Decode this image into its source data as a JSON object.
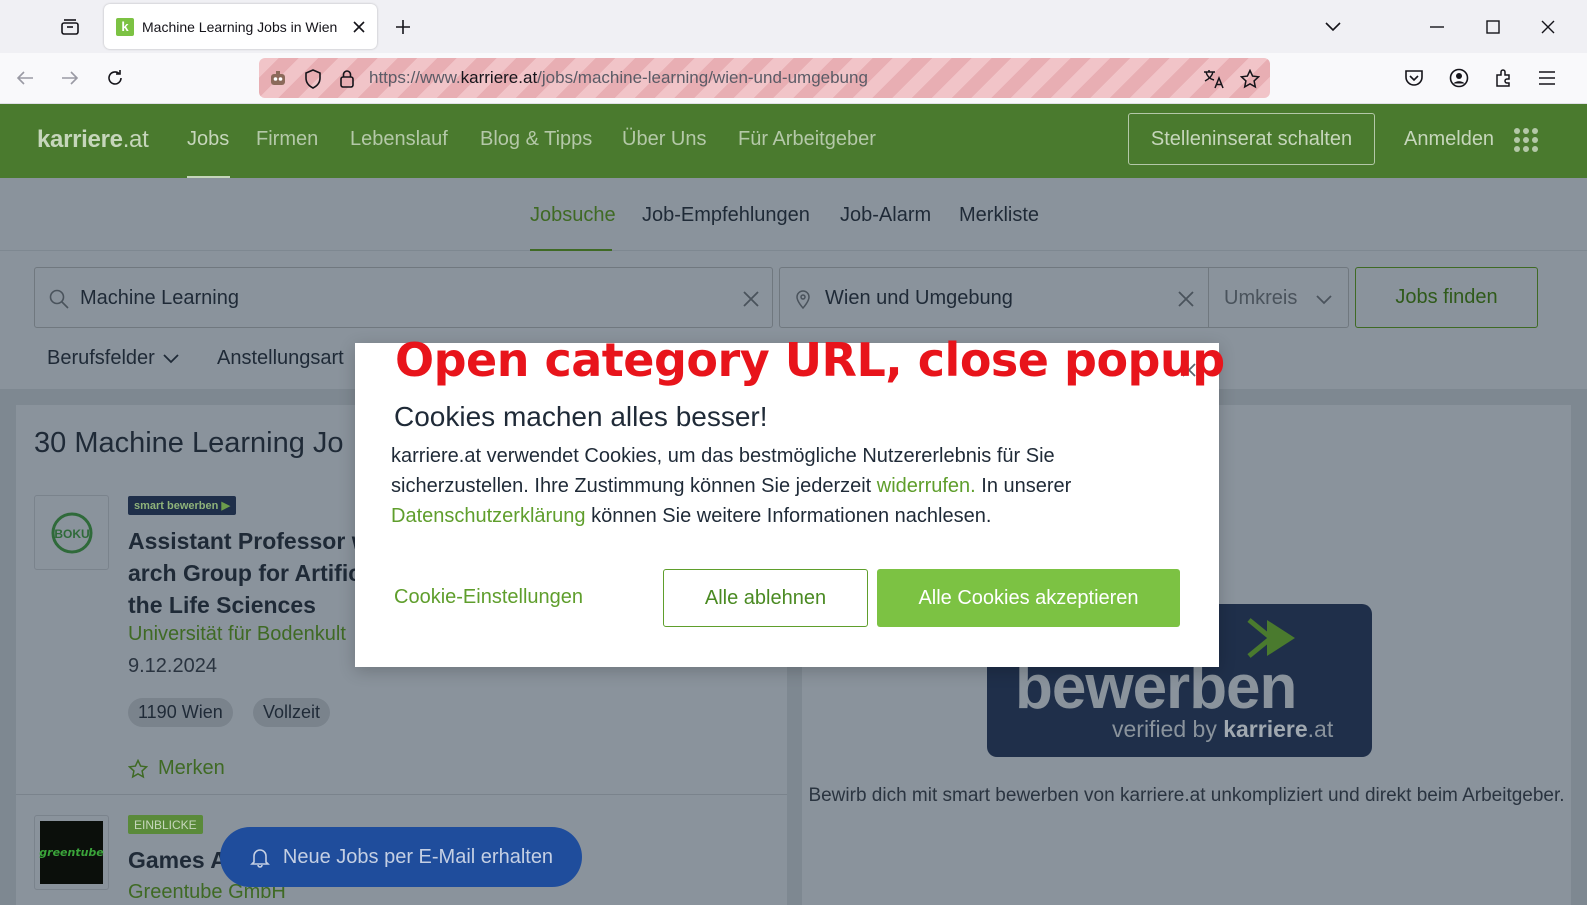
{
  "browser": {
    "tab_title": "Machine Learning Jobs in Wien",
    "url_prefix": "https://www.",
    "url_domain": "karriere.at",
    "url_path": "/jobs/machine-learning/wien-und-umgebung"
  },
  "header": {
    "logo_bold": "karriere",
    "logo_suffix": ".at",
    "nav": [
      "Jobs",
      "Firmen",
      "Lebenslauf",
      "Blog & Tipps",
      "Über Uns",
      "Für Arbeitgeber"
    ],
    "post_job": "Stelleninserat schalten",
    "login": "Anmelden"
  },
  "subnav": [
    "Jobsuche",
    "Job-Empfehlungen",
    "Job-Alarm",
    "Merkliste"
  ],
  "search": {
    "keyword": "Machine Learning",
    "location": "Wien und Umgebung",
    "radius": "Umkreis",
    "submit": "Jobs finden",
    "filters": [
      "Berufsfelder",
      "Anstellungsart"
    ]
  },
  "results": {
    "title": "30 Machine Learning Jo",
    "job1": {
      "badge": "smart bewerben",
      "logo_text": "BOKU",
      "title_lines": [
        "Assistant Professor w",
        "arch Group for Artific",
        "the Life Sciences"
      ],
      "company": "Universität für Bodenkult",
      "date": "9.12.2024",
      "tags": [
        "1190 Wien",
        "Vollzeit"
      ],
      "bookmark": "Merken"
    },
    "job2": {
      "badge": "EINBLICKE",
      "logo_text": "greentube",
      "title": "Games A",
      "company": "Greentube GmbH"
    }
  },
  "promo": {
    "word": "bewerben",
    "verified_prefix": "verified by ",
    "verified_brand": "karriere",
    "verified_suffix": ".at",
    "description": "Bewirb dich mit smart bewerben von karriere.at unkompliziert und direkt beim Arbeitgeber."
  },
  "fab": {
    "label": "Neue Jobs per E-Mail erhalten"
  },
  "annotation": "Open category URL, close popup",
  "cookie_modal": {
    "title": "Cookies machen alles besser!",
    "body_part1": "karriere.at verwendet Cookies, um das bestmögliche Nutzererlebnis für Sie sicherzustellen. Ihre Zustimmung können Sie jederzeit ",
    "link_revoke": "widerrufen.",
    "body_part2": " In unserer ",
    "link_privacy": "Datenschutzerklärung",
    "body_part3": " können Sie weitere Informationen nachlesen.",
    "settings": "Cookie-Einstellungen",
    "reject": "Alle ablehnen",
    "accept": "Alle Cookies akzeptieren"
  },
  "colors": {
    "brand_green": "#7cc243",
    "header_green": "#4a7a2e",
    "annotation_red": "#e8141b"
  }
}
